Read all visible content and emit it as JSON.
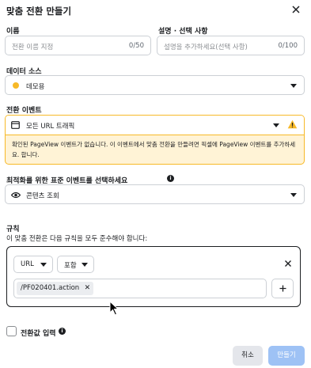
{
  "dialog": {
    "title": "맞춤 전환 만들기"
  },
  "name_field": {
    "label": "이름",
    "placeholder": "전환 이름 지정",
    "counter": "0/50"
  },
  "description_field": {
    "label": "설명 · 선택 사항",
    "placeholder": "설명을 추가하세요(선택 사항)",
    "counter": "0/100"
  },
  "data_source": {
    "label": "데이터 소스",
    "value": "데모용",
    "dot_color": "#f7b928"
  },
  "conversion_event": {
    "label": "전환 이벤트",
    "value": "모든 URL 트래픽",
    "warning": "확인된 PageView 이벤트가 없습니다. 이 이벤트에서 맞춤 전환을 만들려면 픽셀에 PageView 이벤트를 추가하세요. 합니다."
  },
  "optimization": {
    "label": "최적화를 위한 표준 이벤트를 선택하세요",
    "value": "콘텐츠 조회"
  },
  "rules": {
    "label": "규칙",
    "description": "이 맞춤 전환은 다음 규칙을 모두 준수해야 합니다:",
    "field_select": "URL",
    "operator_select": "포함",
    "tag_value": "/PF020401.action"
  },
  "conversion_value": {
    "label": "전환값 입력"
  },
  "footer": {
    "cancel_label": "취소",
    "create_label": "만들기"
  },
  "colors": {
    "warning_border": "#f7b928",
    "warning_bg": "#fff3d6",
    "primary_disabled": "#9ec2f5"
  }
}
